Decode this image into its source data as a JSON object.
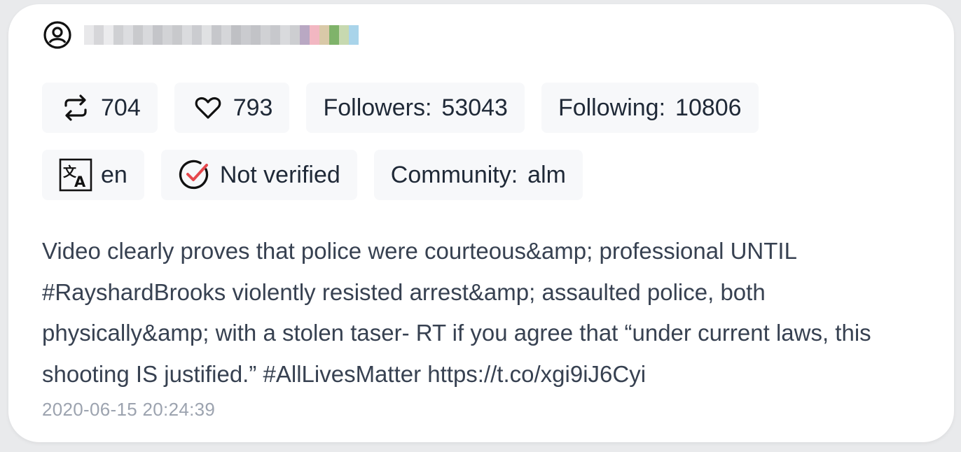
{
  "user": {
    "icon": "user-circle-icon",
    "username_blurred": true
  },
  "stats": {
    "retweets": {
      "icon": "retweet-icon",
      "value": "704"
    },
    "likes": {
      "icon": "heart-icon",
      "value": "793"
    },
    "followers": {
      "label": "Followers:",
      "value": "53043"
    },
    "following": {
      "label": "Following:",
      "value": "10806"
    }
  },
  "meta": {
    "language": {
      "icon": "translate-icon",
      "value": "en"
    },
    "verification": {
      "icon": "check-circle-icon",
      "value": "Not verified",
      "accent": "#e5484d"
    },
    "community": {
      "label": "Community:",
      "value": "alm"
    }
  },
  "tweet": {
    "text": "Video clearly proves that police were courteous&amp; professional UNTIL #RayshardBrooks violently resisted arrest&amp; assaulted police, both physically&amp; with a stolen taser- RT if you agree that “under current laws, this shooting IS justified.” #AllLivesMatter https://t.co/xgi9iJ6Cyi",
    "timestamp": "2020-06-15 20:24:39"
  }
}
